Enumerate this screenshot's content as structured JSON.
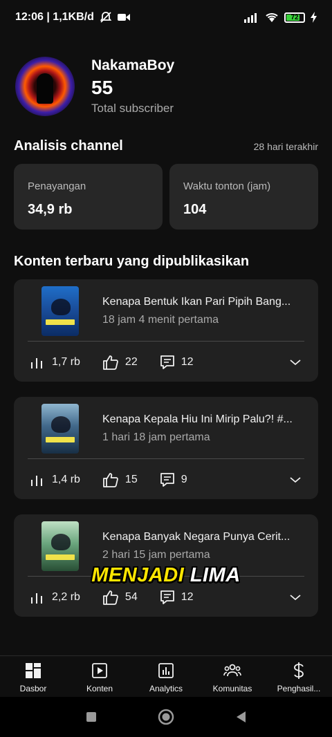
{
  "status_bar": {
    "time_speed": "12:06 | 1,1KB/d",
    "battery": "72"
  },
  "profile": {
    "channel_name": "NakamaBoy",
    "subscriber_count": "55",
    "subscriber_label": "Total subscriber"
  },
  "analytics": {
    "title": "Analisis channel",
    "period": "28 hari terakhir",
    "views_label": "Penayangan",
    "views_value": "34,9 rb",
    "watch_label": "Waktu tonton (jam)",
    "watch_value": "104"
  },
  "recent": {
    "title": "Konten terbaru yang dipublikasikan",
    "videos": [
      {
        "title": "Kenapa Bentuk Ikan Pari Pipih Bang...",
        "age": "18 jam 4 menit pertama",
        "views": "1,7 rb",
        "likes": "22",
        "comments": "12"
      },
      {
        "title": "Kenapa Kepala Hiu Ini Mirip Palu?! #...",
        "age": "1 hari 18 jam pertama",
        "views": "1,4 rb",
        "likes": "15",
        "comments": "9"
      },
      {
        "title": "Kenapa Banyak Negara Punya Cerit...",
        "age": "2 hari 15 jam pertama",
        "views": "2,2 rb",
        "likes": "54",
        "comments": "12"
      }
    ]
  },
  "caption": {
    "word1": "MENJADI",
    "word2": "LIMA"
  },
  "nav": {
    "items": [
      {
        "label": "Dasbor",
        "icon": "dashboard-icon"
      },
      {
        "label": "Konten",
        "icon": "content-icon"
      },
      {
        "label": "Analytics",
        "icon": "analytics-icon"
      },
      {
        "label": "Komunitas",
        "icon": "community-icon"
      },
      {
        "label": "Penghasil...",
        "icon": "earn-icon"
      }
    ]
  },
  "colors": {
    "background": "#0f0f0f",
    "card": "#272727",
    "caption_yellow": "#ffe600",
    "battery_green": "#38d13a"
  }
}
